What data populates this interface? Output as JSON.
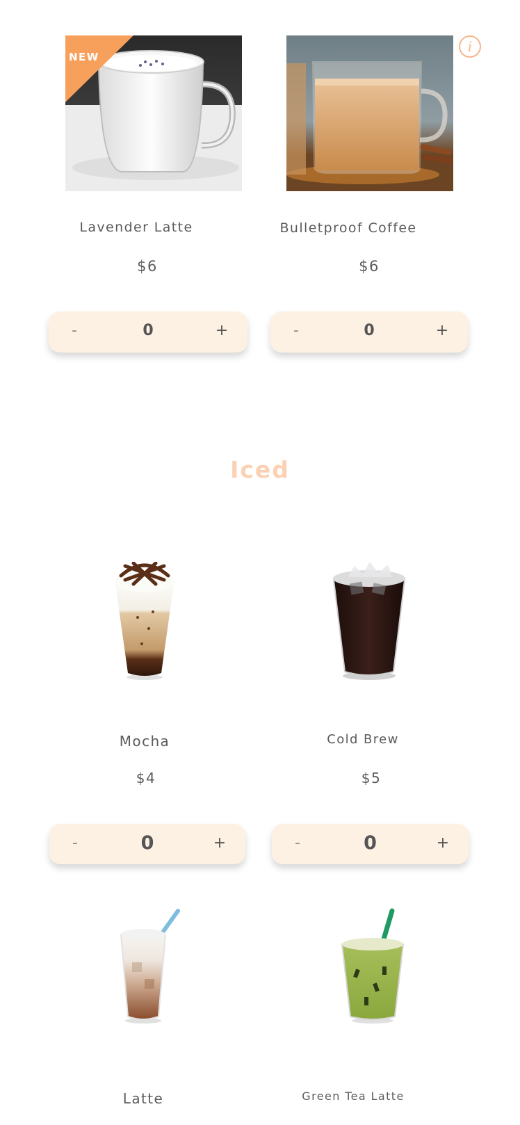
{
  "colors": {
    "accent": "#f7a05c",
    "accent_light": "#fcd1b3",
    "stepper_bg": "#fdf1e3",
    "text": "#555555"
  },
  "hot_items": [
    {
      "name": "Lavender Latte",
      "price": "$6",
      "quantity": "0",
      "badge": "NEW",
      "image": "lavender-latte-photo"
    },
    {
      "name": "Bulletproof Coffee",
      "price": "$6",
      "quantity": "0",
      "image": "bulletproof-coffee-photo"
    }
  ],
  "info_icon": "info-icon",
  "stepper": {
    "minus": "-",
    "plus": "+"
  },
  "section": {
    "title": "Iced"
  },
  "iced_items": [
    {
      "name": "Mocha",
      "price": "$4",
      "quantity": "0",
      "image": "iced-mocha-photo"
    },
    {
      "name": "Cold Brew",
      "price": "$5",
      "quantity": "0",
      "image": "cold-brew-photo"
    },
    {
      "name": "Latte",
      "image": "iced-latte-photo"
    },
    {
      "name": "Green Tea Latte",
      "image": "green-tea-latte-photo"
    }
  ]
}
